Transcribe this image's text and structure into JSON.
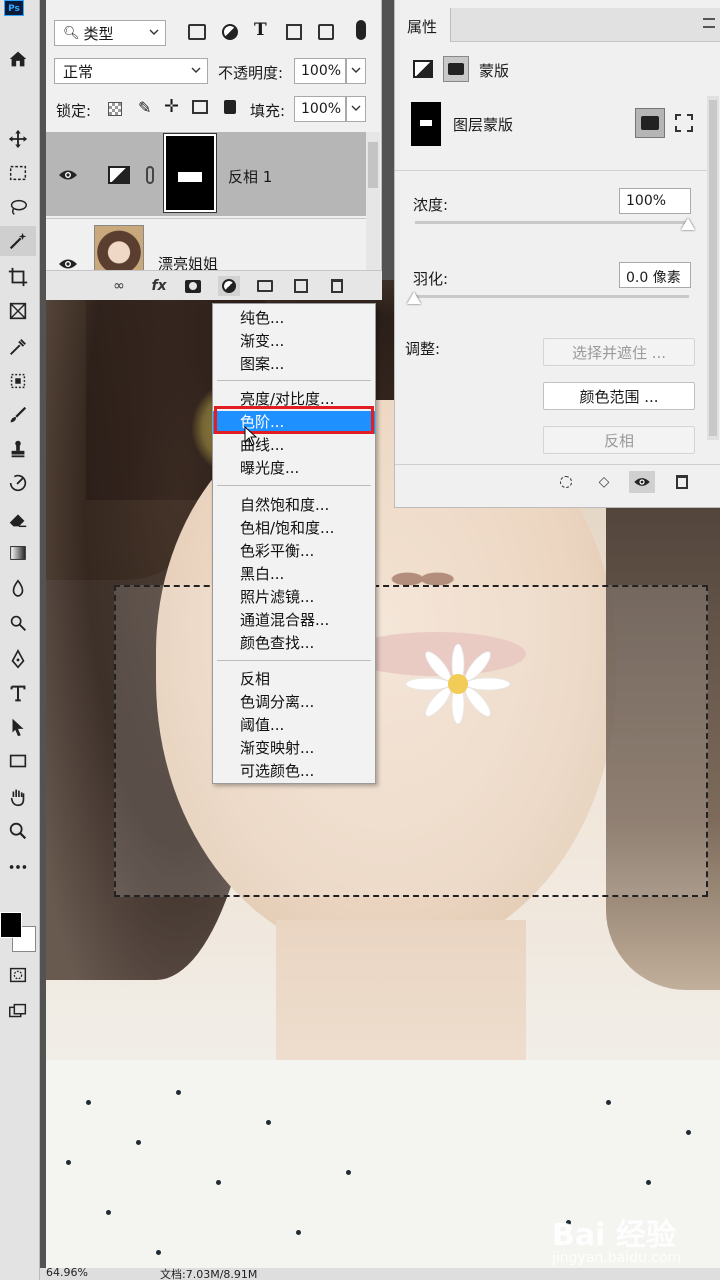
{
  "app": {
    "logo": "Ps"
  },
  "layers_panel": {
    "filter_kind": "类型",
    "blend_mode": "正常",
    "opacity_label": "不透明度:",
    "opacity_value": "100%",
    "lock_label": "锁定:",
    "fill_label": "填充:",
    "fill_value": "100%",
    "layers": [
      {
        "name": "反相 1"
      },
      {
        "name": "漂亮姐姐"
      }
    ]
  },
  "properties_panel": {
    "tab": "属性",
    "mask_type": "蒙版",
    "layer_mask_label": "图层蒙版",
    "density_label": "浓度:",
    "density_value": "100%",
    "feather_label": "羽化:",
    "feather_value": "0.0 像素",
    "adjust_label": "调整:",
    "btn_select_mask": "选择并遮住 ...",
    "btn_color_range": "颜色范围 ...",
    "btn_invert": "反相"
  },
  "adjust_menu": {
    "group1": [
      "纯色...",
      "渐变...",
      "图案..."
    ],
    "group2": [
      "亮度/对比度...",
      "色阶...",
      "曲线...",
      "曝光度..."
    ],
    "group3": [
      "自然饱和度...",
      "色相/饱和度...",
      "色彩平衡...",
      "黑白...",
      "照片滤镜...",
      "通道混合器...",
      "颜色查找..."
    ],
    "group4": [
      "反相",
      "色调分离...",
      "阈值...",
      "渐变映射...",
      "可选颜色..."
    ],
    "highlighted": "色阶..."
  },
  "status_bar": {
    "zoom": "64.96%",
    "doc": "文档:7.03M/8.91M"
  },
  "watermark": {
    "brand": "Bai 经验",
    "sub": "jingyan.baidu.com"
  },
  "colors": {
    "accent": "#1e90ff",
    "highlight_box": "#e01e24",
    "selected_layer": "#b6b6b6"
  }
}
